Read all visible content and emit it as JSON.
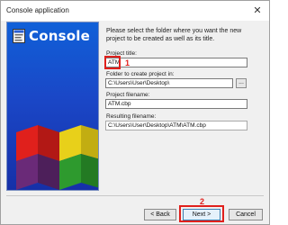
{
  "window": {
    "title": "Console application",
    "close_glyph": "✕"
  },
  "banner": {
    "logo_text": "Console",
    "logo_icon": "console-window-icon"
  },
  "instruction": "Please select the folder where you want the new project to be created as well as its title.",
  "fields": {
    "project_title": {
      "label": "Project title:",
      "value": "ATM"
    },
    "folder": {
      "label": "Folder to create project in:",
      "value": "C:\\Users\\User\\Desktop\\",
      "browse_label": "..."
    },
    "project_filename": {
      "label": "Project filename:",
      "value": "ATM.cbp"
    },
    "resulting_filename": {
      "label": "Resulting filename:",
      "value": "C:\\Users\\User\\Desktop\\ATM\\ATM.cbp"
    }
  },
  "annotations": {
    "step1": "1",
    "step2": "2",
    "color": "#e0201c"
  },
  "buttons": {
    "back": "< Back",
    "next": "Next >",
    "cancel": "Cancel"
  }
}
